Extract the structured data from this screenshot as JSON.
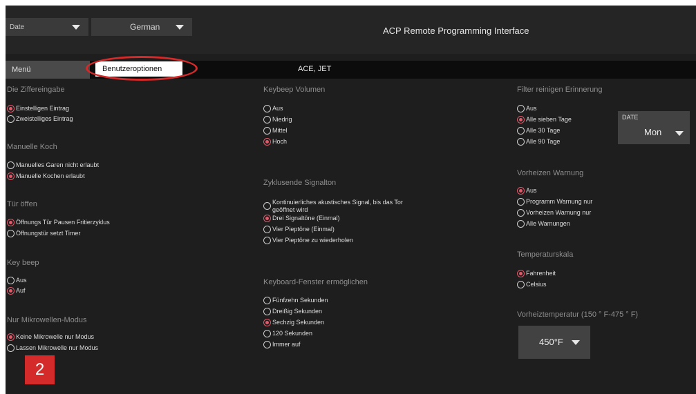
{
  "header": {
    "date_dropdown": "Date",
    "language_dropdown": "German",
    "title": "ACP Remote Programming Interface"
  },
  "tabs": {
    "menu": "Menü",
    "active": "Benutzeroptionen",
    "model": "ACE, JET"
  },
  "left": {
    "digit_entry": {
      "title": "Die Ziffereingabe",
      "options": [
        {
          "label": "Einstelligen Eintrag",
          "selected": true
        },
        {
          "label": "Zweistelliges Eintrag",
          "selected": false
        }
      ]
    },
    "manual_cook": {
      "title": "Manuelle Koch",
      "options": [
        {
          "label": "Manuelles Garen nicht erlaubt",
          "selected": false
        },
        {
          "label": "Manuelle Kochen erlaubt",
          "selected": true
        }
      ]
    },
    "door_open": {
      "title": "Tür öffen",
      "options": [
        {
          "label": "Öffnungs Tür Pausen Fritierzyklus",
          "selected": true
        },
        {
          "label": "Öffnungstür setzt Timer",
          "selected": false
        }
      ]
    },
    "key_beep": {
      "title": "Key beep",
      "options": [
        {
          "label": "Aus",
          "selected": false
        },
        {
          "label": "Auf",
          "selected": true
        }
      ]
    },
    "microwave_only": {
      "title": "Nur Mikrowellen-Modus",
      "options": [
        {
          "label": "Keine Mikrowelle nur Modus",
          "selected": true
        },
        {
          "label": "Lassen Mikrowelle nur Modus",
          "selected": false
        }
      ]
    }
  },
  "middle": {
    "keybeep_volume": {
      "title": "Keybeep Volumen",
      "options": [
        {
          "label": "Aus",
          "selected": false
        },
        {
          "label": "Niedrig",
          "selected": false
        },
        {
          "label": "Mittel",
          "selected": false
        },
        {
          "label": "Hoch",
          "selected": true
        }
      ]
    },
    "cycle_signal": {
      "title": "Zyklusende Signalton",
      "options": [
        {
          "label": "Kontinuierliches akustisches Signal, bis das Tor geöffnet wird",
          "selected": false
        },
        {
          "label": "Drei Signaltöne (Einmal)",
          "selected": true
        },
        {
          "label": "Vier Pieptöne (Einmal)",
          "selected": false
        },
        {
          "label": "Vier Pieptöne zu wiederholen",
          "selected": false
        }
      ]
    },
    "keyboard_window": {
      "title": "Keyboard-Fenster ermöglichen",
      "options": [
        {
          "label": "Fünfzehn Sekunden",
          "selected": false
        },
        {
          "label": "Dreißig Sekunden",
          "selected": false
        },
        {
          "label": "Sechzig Sekunden",
          "selected": true
        },
        {
          "label": "120 Sekunden",
          "selected": false
        },
        {
          "label": "Immer auf",
          "selected": false
        }
      ]
    }
  },
  "right": {
    "filter_reminder": {
      "title": "Filter reinigen Erinnerung",
      "options": [
        {
          "label": "Aus",
          "selected": false
        },
        {
          "label": "Alle sieben Tage",
          "selected": true
        },
        {
          "label": "Alle 30 Tage",
          "selected": false
        },
        {
          "label": "Alle 90 Tage",
          "selected": false
        }
      ]
    },
    "date_select": {
      "label": "DATE",
      "value": "Mon"
    },
    "preheat_warning": {
      "title": "Vorheizen Warnung",
      "options": [
        {
          "label": "Aus",
          "selected": true
        },
        {
          "label": "Programm Warnung nur",
          "selected": false
        },
        {
          "label": "Vorheizen Warnung nur",
          "selected": false
        },
        {
          "label": "Alle Warnungen",
          "selected": false
        }
      ]
    },
    "temp_scale": {
      "title": "Temperaturskala",
      "options": [
        {
          "label": "Fahrenheit",
          "selected": true
        },
        {
          "label": "Celsius",
          "selected": false
        }
      ]
    },
    "preheat_temp": {
      "title": "Vorheiztemperatur (150 ° F-475 ° F)",
      "value": "450°F"
    }
  },
  "step_badge": "2",
  "colors": {
    "background": "#1e1e1e",
    "selected_radio": "#e05a6a",
    "highlight": "#d42a2a"
  }
}
